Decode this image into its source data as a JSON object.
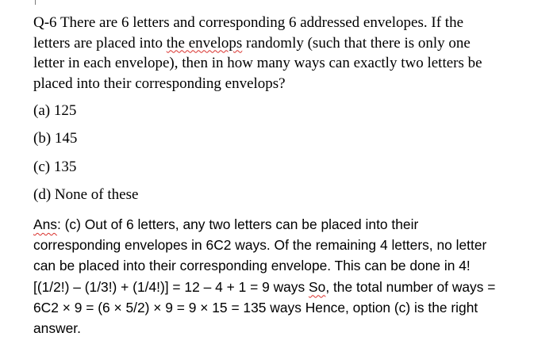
{
  "question": {
    "line1": "Q-6 There are 6 letters and corresponding 6 addressed envelopes. If the",
    "line2_pre": "letters are placed into ",
    "line2_flag": "the envelops",
    "line2_post": " randomly (such that there is only one",
    "line3": "letter in each envelope), then in how many ways can exactly two letters be",
    "line4": "placed into their corresponding envelops?"
  },
  "options": {
    "a": "(a) 125",
    "b": "(b) 145",
    "c": "(c) 135",
    "d": "(d) None of these"
  },
  "answer": {
    "line1_flag": "Ans",
    "line1_post": ": (c) Out of 6 letters, any two letters can be placed into their",
    "line2": "corresponding envelopes in 6C2 ways. Of the remaining 4 letters, no letter",
    "line3": "can be placed into their corresponding envelope. This can be done in 4!",
    "line4_pre": "[(1/2!) – (1/3!) + (1/4!)] = 12 – 4 + 1 = 9 ways ",
    "line4_flag": "So",
    "line4_post": ", the total number of ways =",
    "line5": "6C2 × 9 = (6 × 5/2) × 9 = 9 × 15 = 135 ways Hence, option (c) is the right",
    "line6": "answer."
  },
  "colors": {
    "text": "#000000",
    "spellcheck_underline": "#d9302c",
    "background": "#ffffff"
  }
}
